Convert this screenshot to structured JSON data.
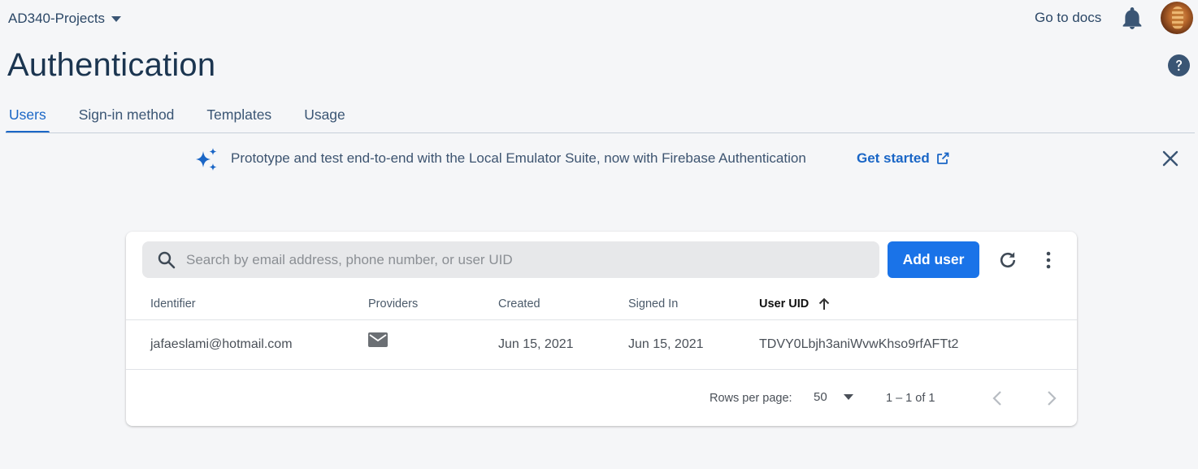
{
  "header": {
    "project_name": "AD340-Projects",
    "docs_link": "Go to docs"
  },
  "page": {
    "title": "Authentication"
  },
  "tabs": [
    {
      "label": "Users",
      "active": true
    },
    {
      "label": "Sign-in method",
      "active": false
    },
    {
      "label": "Templates",
      "active": false
    },
    {
      "label": "Usage",
      "active": false
    }
  ],
  "banner": {
    "text": "Prototype and test end-to-end with the Local Emulator Suite, now with Firebase Authentication",
    "link": "Get started"
  },
  "users_table": {
    "search_placeholder": "Search by email address, phone number, or user UID",
    "add_user_label": "Add user",
    "columns": [
      "Identifier",
      "Providers",
      "Created",
      "Signed In",
      "User UID"
    ],
    "sorted_column": "User UID",
    "rows": [
      {
        "identifier": "jafaeslami@hotmail.com",
        "provider_icon": "mail-icon",
        "created": "Jun 15, 2021",
        "signed_in": "Jun 15, 2021",
        "uid": "TDVY0Lbjh3aniWvwKhso9rfAFTt2"
      }
    ],
    "pagination": {
      "rows_per_page_label": "Rows per page:",
      "rows_per_page": "50",
      "range": "1 – 1 of 1"
    }
  },
  "colors": {
    "accent": "#1a73e8",
    "active_tab": "#1a66c6",
    "background": "#f5f6f8"
  }
}
